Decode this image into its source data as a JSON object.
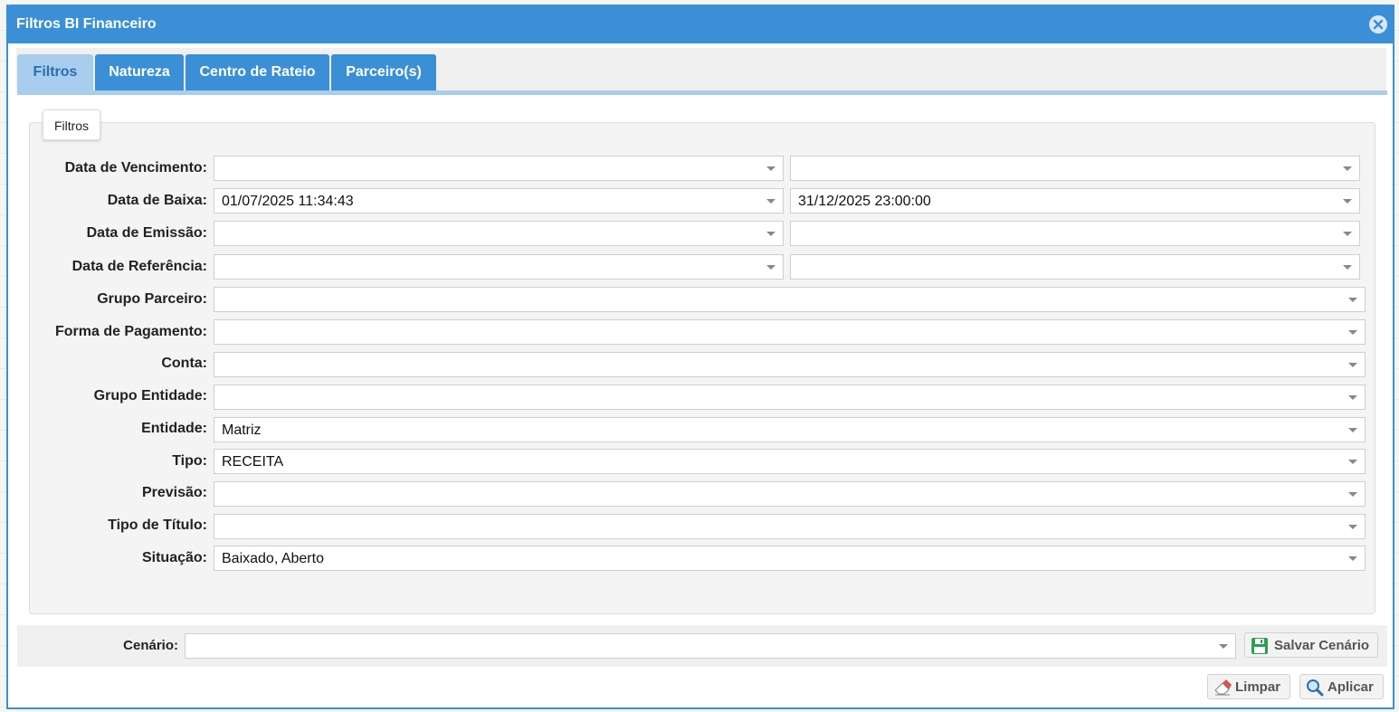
{
  "dialog": {
    "title": "Filtros BI Financeiro"
  },
  "tabs": [
    {
      "label": "Filtros",
      "active": true
    },
    {
      "label": "Natureza",
      "active": false
    },
    {
      "label": "Centro de Rateio",
      "active": false
    },
    {
      "label": "Parceiro(s)",
      "active": false
    }
  ],
  "fieldset": {
    "legend": "Filtros",
    "fields": [
      {
        "label": "Data de Vencimento:",
        "value_from": "",
        "value_to": ""
      },
      {
        "label": "Data de Baixa:",
        "value_from": "01/07/2025 11:34:43",
        "value_to": "31/12/2025 23:00:00"
      },
      {
        "label": "Data de Emissão:",
        "value_from": "",
        "value_to": ""
      },
      {
        "label": "Data de Referência:",
        "value_from": "",
        "value_to": ""
      },
      {
        "label": "Grupo Parceiro:",
        "value": ""
      },
      {
        "label": "Forma de Pagamento:",
        "value": ""
      },
      {
        "label": "Conta:",
        "value": ""
      },
      {
        "label": "Grupo Entidade:",
        "value": ""
      },
      {
        "label": "Entidade:",
        "value": "Matriz"
      },
      {
        "label": "Tipo:",
        "value": "RECEITA"
      },
      {
        "label": "Previsão:",
        "value": ""
      },
      {
        "label": "Tipo de Título:",
        "value": ""
      },
      {
        "label": "Situação:",
        "value": "Baixado, Aberto"
      }
    ]
  },
  "footer": {
    "scenario_label": "Cenário:",
    "scenario_value": "",
    "save_scenario_label": "Salvar Cenário",
    "clear_label": "Limpar",
    "apply_label": "Aplicar"
  },
  "colors": {
    "titlebar": "#3b8fd6",
    "tab_active": "#a8cdee",
    "save_icon": "#2e9e4f",
    "eraser_icon": "#d9534f"
  },
  "icons": {
    "close": "close-icon",
    "save": "floppy-disk-icon",
    "clear": "eraser-icon",
    "apply": "magnifier-icon",
    "dropdown": "chevron-down-icon"
  }
}
